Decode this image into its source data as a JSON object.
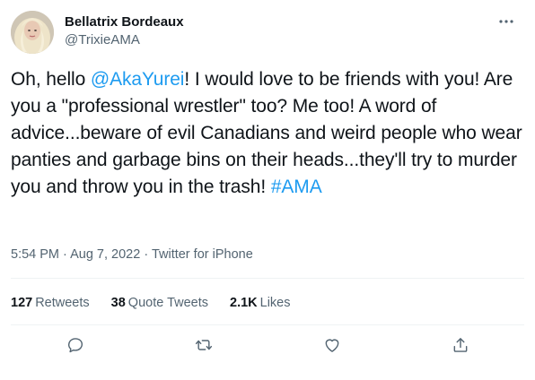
{
  "tweet": {
    "author": {
      "display_name": "Bellatrix Bordeaux",
      "handle": "@TrixieAMA"
    },
    "text": {
      "part1": "Oh, hello ",
      "mention": "@AkaYurei",
      "part2": "! I would love to be friends with you! Are you a \"professional wrestler\" too? Me too! A word of advice...beware of evil Canadians and weird people who wear panties and garbage bins on their heads...they'll try to murder you and throw you in the trash! ",
      "hashtag": "#AMA"
    },
    "meta": {
      "time": "5:54 PM",
      "separator1": " · ",
      "date": "Aug 7, 2022",
      "separator2": " · ",
      "source": "Twitter for iPhone"
    },
    "stats": {
      "retweets_count": "127",
      "retweets_label": "Retweets",
      "quotes_count": "38",
      "quotes_label": "Quote Tweets",
      "likes_count": "2.1K",
      "likes_label": "Likes"
    },
    "actions": {
      "reply_icon": "reply-icon",
      "retweet_icon": "retweet-icon",
      "like_icon": "heart-icon",
      "share_icon": "share-icon"
    }
  },
  "colors": {
    "link": "#1d9bf0",
    "text": "#0f1419",
    "secondary": "#536471",
    "divider": "#eff3f4"
  }
}
